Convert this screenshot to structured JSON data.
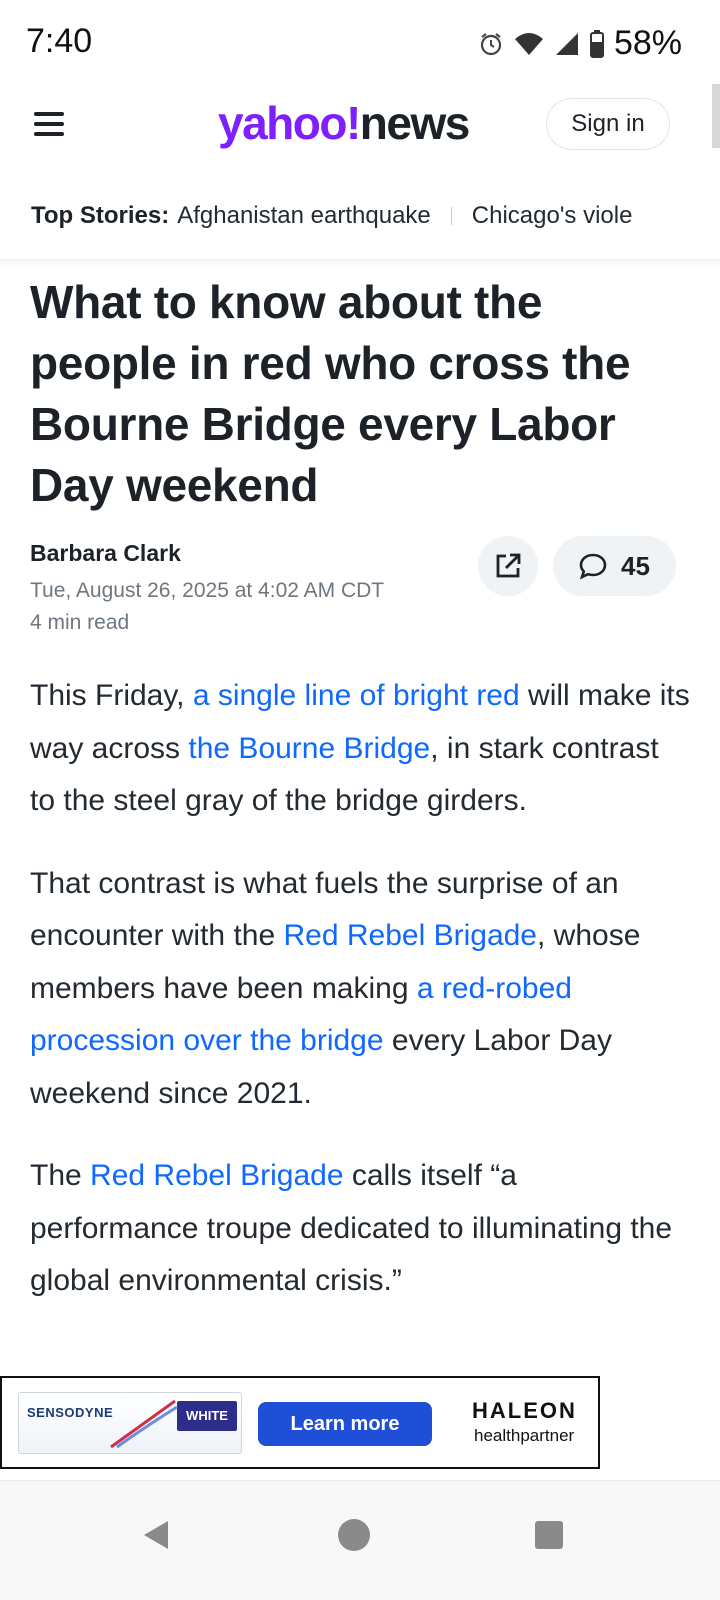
{
  "status_bar": {
    "time": "7:40",
    "battery": "58%",
    "icons": [
      "alarm-icon",
      "wifi-icon",
      "signal-icon",
      "battery-icon"
    ]
  },
  "header": {
    "logo_yahoo": "yahoo!",
    "logo_news": "news",
    "sign_in": "Sign in",
    "brand_color": "#7e1fff"
  },
  "top_stories": {
    "label": "Top Stories:",
    "items": [
      "Afghanistan earthquake",
      "Chicago's viole"
    ]
  },
  "article": {
    "headline": "What to know about the people in red who cross the Bourne Bridge every Labor Day weekend",
    "author": "Barbara Clark",
    "date": "Tue, August 26, 2025 at 4:02 AM CDT",
    "read_time": "4 min read",
    "comment_count": "45",
    "link_color": "#0f69ff",
    "paragraphs": [
      {
        "t1": "This Friday, ",
        "l1": "a single line of bright red",
        "t2": " will make its way across ",
        "l2": "the Bourne Bridge",
        "t3": ", in stark contrast to the steel gray of the bridge girders."
      },
      {
        "t1": "That contrast is what fuels the surprise of an encounter with the ",
        "l1": "Red Rebel Brigade",
        "t2": ", whose members have been making ",
        "l2": "a red-robed procession over the bridge",
        "t3": " every Labor Day weekend since 2021."
      },
      {
        "t1": "The ",
        "l1": "Red Rebel Brigade",
        "t2": " calls itself “a performance troupe dedicated to illuminating the global environmental crisis.”"
      }
    ]
  },
  "ad": {
    "brand": "SENSODYNE",
    "product": "WHITE",
    "cta": "Learn more",
    "sponsor": "HALEON",
    "sponsor_sub": "healthpartner",
    "cta_color": "#1f4fd6"
  },
  "nav": {
    "back": "back-icon",
    "home": "home-icon",
    "recents": "recents-icon"
  }
}
